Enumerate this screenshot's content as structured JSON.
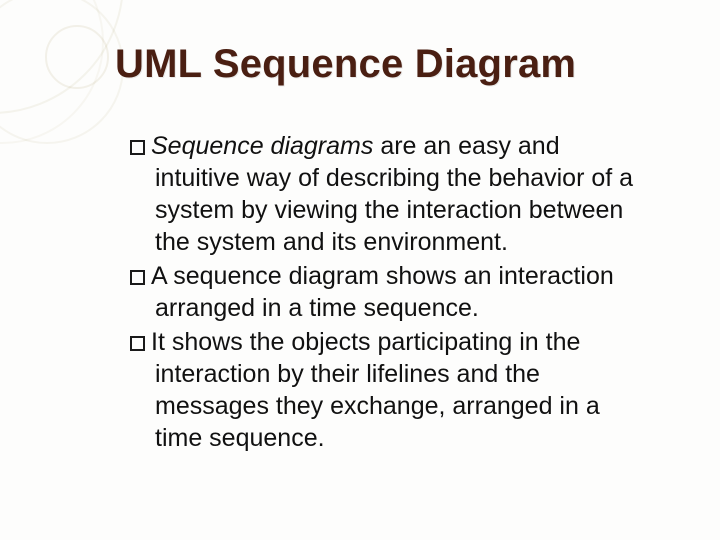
{
  "slide": {
    "title": "UML Sequence Diagram",
    "bullets": [
      {
        "lead": "Sequence diagrams",
        "rest": " are an easy and intuitive way of describing the behavior of a system by viewing the interaction between the system and its environment."
      },
      {
        "lead": "",
        "rest": "A sequence diagram shows an interaction arranged in a time sequence."
      },
      {
        "lead": "",
        "rest": "It shows the objects participating in the interaction by their lifelines and the messages they exchange, arranged in a time sequence."
      }
    ]
  }
}
